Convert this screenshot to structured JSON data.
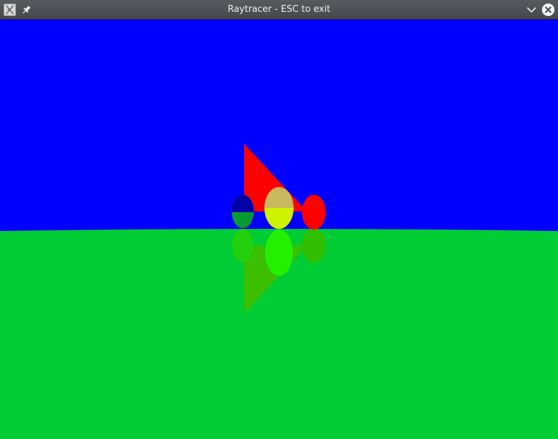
{
  "window": {
    "title": "Raytracer - ESC to exit",
    "app_icon": "raytracer-app-icon",
    "pin_icon": "pin-icon",
    "minimize_icon": "chevron-down-icon",
    "close_icon": "close-icon"
  },
  "scene": {
    "sky_color": "#0000ff",
    "ground_color": "#00cc33",
    "triangle_color": "#ff0000",
    "sphere_left_color": "#0000aa",
    "sphere_mid_color": "#c8c85a",
    "sphere_right_color": "#ff0000",
    "reflection_color": "#2dc400"
  }
}
